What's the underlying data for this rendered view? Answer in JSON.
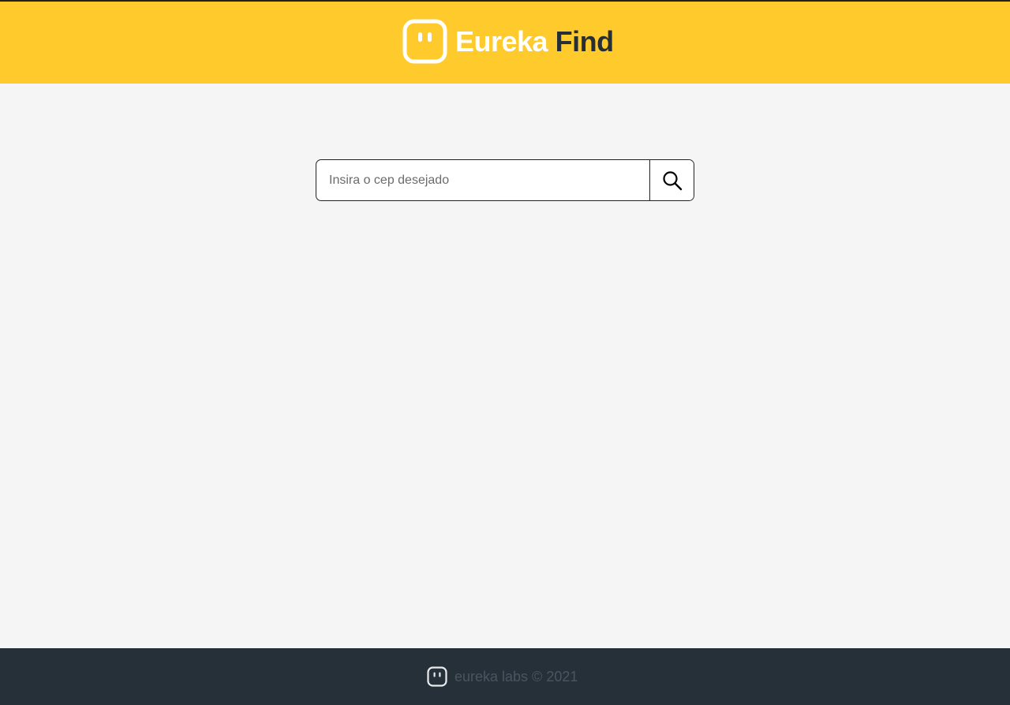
{
  "header": {
    "brand_first": "Eureka",
    "brand_second": "Find",
    "logo_icon": "eureka-face-icon",
    "background_color": "#ffca2c"
  },
  "search": {
    "placeholder": "Insira o cep desejado",
    "value": "",
    "button_icon": "search-icon"
  },
  "footer": {
    "text": "eureka labs © 2021",
    "logo_icon": "eureka-face-icon",
    "background_color": "#263039"
  },
  "colors": {
    "accent": "#ffca2c",
    "dark": "#262f36",
    "page_background": "#f5f5f5"
  }
}
